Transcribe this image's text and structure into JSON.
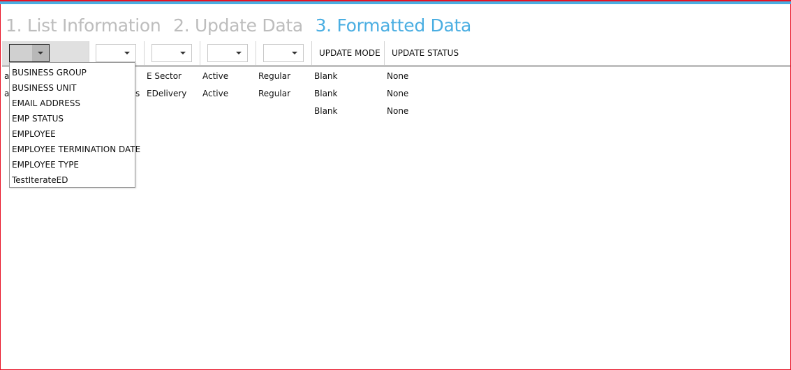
{
  "steps": [
    {
      "label": "1. List Information",
      "active": false
    },
    {
      "label": "2. Update Data",
      "active": false
    },
    {
      "label": "3. Formatted Data",
      "active": true
    }
  ],
  "colors": {
    "accent": "#4aaee2",
    "inactive_step": "#bdbdbd",
    "window_border": "#e81123"
  },
  "columns": {
    "update_mode": "UPDATE MODE",
    "update_status": "UPDATE STATUS"
  },
  "rows": [
    {
      "c1": "a",
      "c2": "",
      "c3": "E Sector",
      "c4": "Active",
      "c5": "Regular",
      "mode": "Blank",
      "status": "None"
    },
    {
      "c1": "a",
      "c2": "s",
      "c3": "EDelivery",
      "c4": "Active",
      "c5": "Regular",
      "mode": "Blank",
      "status": "None"
    },
    {
      "c1": "",
      "c2": "",
      "c3": "",
      "c4": "",
      "c5": "",
      "mode": "Blank",
      "status": "None"
    }
  ],
  "dropdown_options": [
    "BUSINESS GROUP",
    "BUSINESS UNIT",
    "EMAIL ADDRESS",
    "EMP STATUS",
    "EMPLOYEE",
    "EMPLOYEE TERMINATION DATE",
    "EMPLOYEE TYPE",
    "TestIterateED"
  ]
}
